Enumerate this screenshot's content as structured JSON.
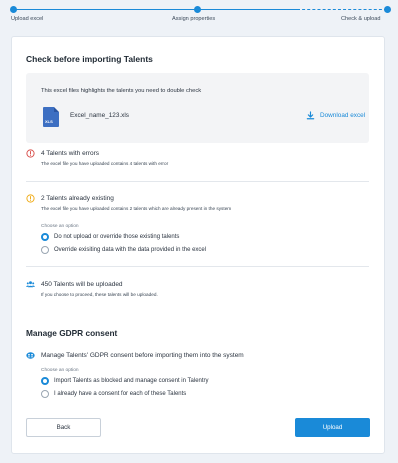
{
  "stepper": {
    "steps": [
      {
        "label": "Upload excel"
      },
      {
        "label": "Assign properties"
      },
      {
        "label": "Check & upload"
      }
    ]
  },
  "check": {
    "title": "Check before importing Talents",
    "file_box": {
      "intro": "This excel files highlights the talents you need to double check",
      "file_type": "XLS",
      "file_name": "Excel_name_123.xls",
      "download_label": "Download excel"
    },
    "errors": {
      "title": "4 Talents with errors",
      "desc": "The excel file you have uploaded contains 4 talents with error"
    },
    "existing": {
      "title": "2 Talents already existing",
      "desc": "The excel file you have uploaded contains 2 talents which are already present in the system",
      "choose_label": "Choose an option",
      "options": [
        {
          "label": "Do not upload or override those existing talents",
          "selected": true
        },
        {
          "label": "Override exisiting data with the data provided in the excel",
          "selected": false
        }
      ]
    },
    "upload": {
      "title": "450 Talents will be uploaded",
      "desc": "If you choose to proceed, these talents will be uploaded."
    }
  },
  "gdpr": {
    "title": "Manage GDPR consent",
    "subtitle": "Manage Talents' GDPR consent before importing them into the system",
    "choose_label": "Choose an option",
    "options": [
      {
        "label": "Import Talents as blocked and manage consent in Talentry",
        "selected": true
      },
      {
        "label": "I already have a consent for each of these Talents",
        "selected": false
      }
    ]
  },
  "buttons": {
    "back": "Back",
    "upload": "Upload"
  },
  "colors": {
    "accent": "#1a8ad8",
    "error": "#d9534f",
    "warning": "#f0ad1c",
    "background": "#eef2f7"
  },
  "icons": {
    "errors": "error-circle-icon",
    "existing": "warning-circle-icon",
    "upload": "users-group-icon",
    "gdpr": "shield-users-icon",
    "download": "download-icon",
    "file": "xls-file-icon"
  }
}
